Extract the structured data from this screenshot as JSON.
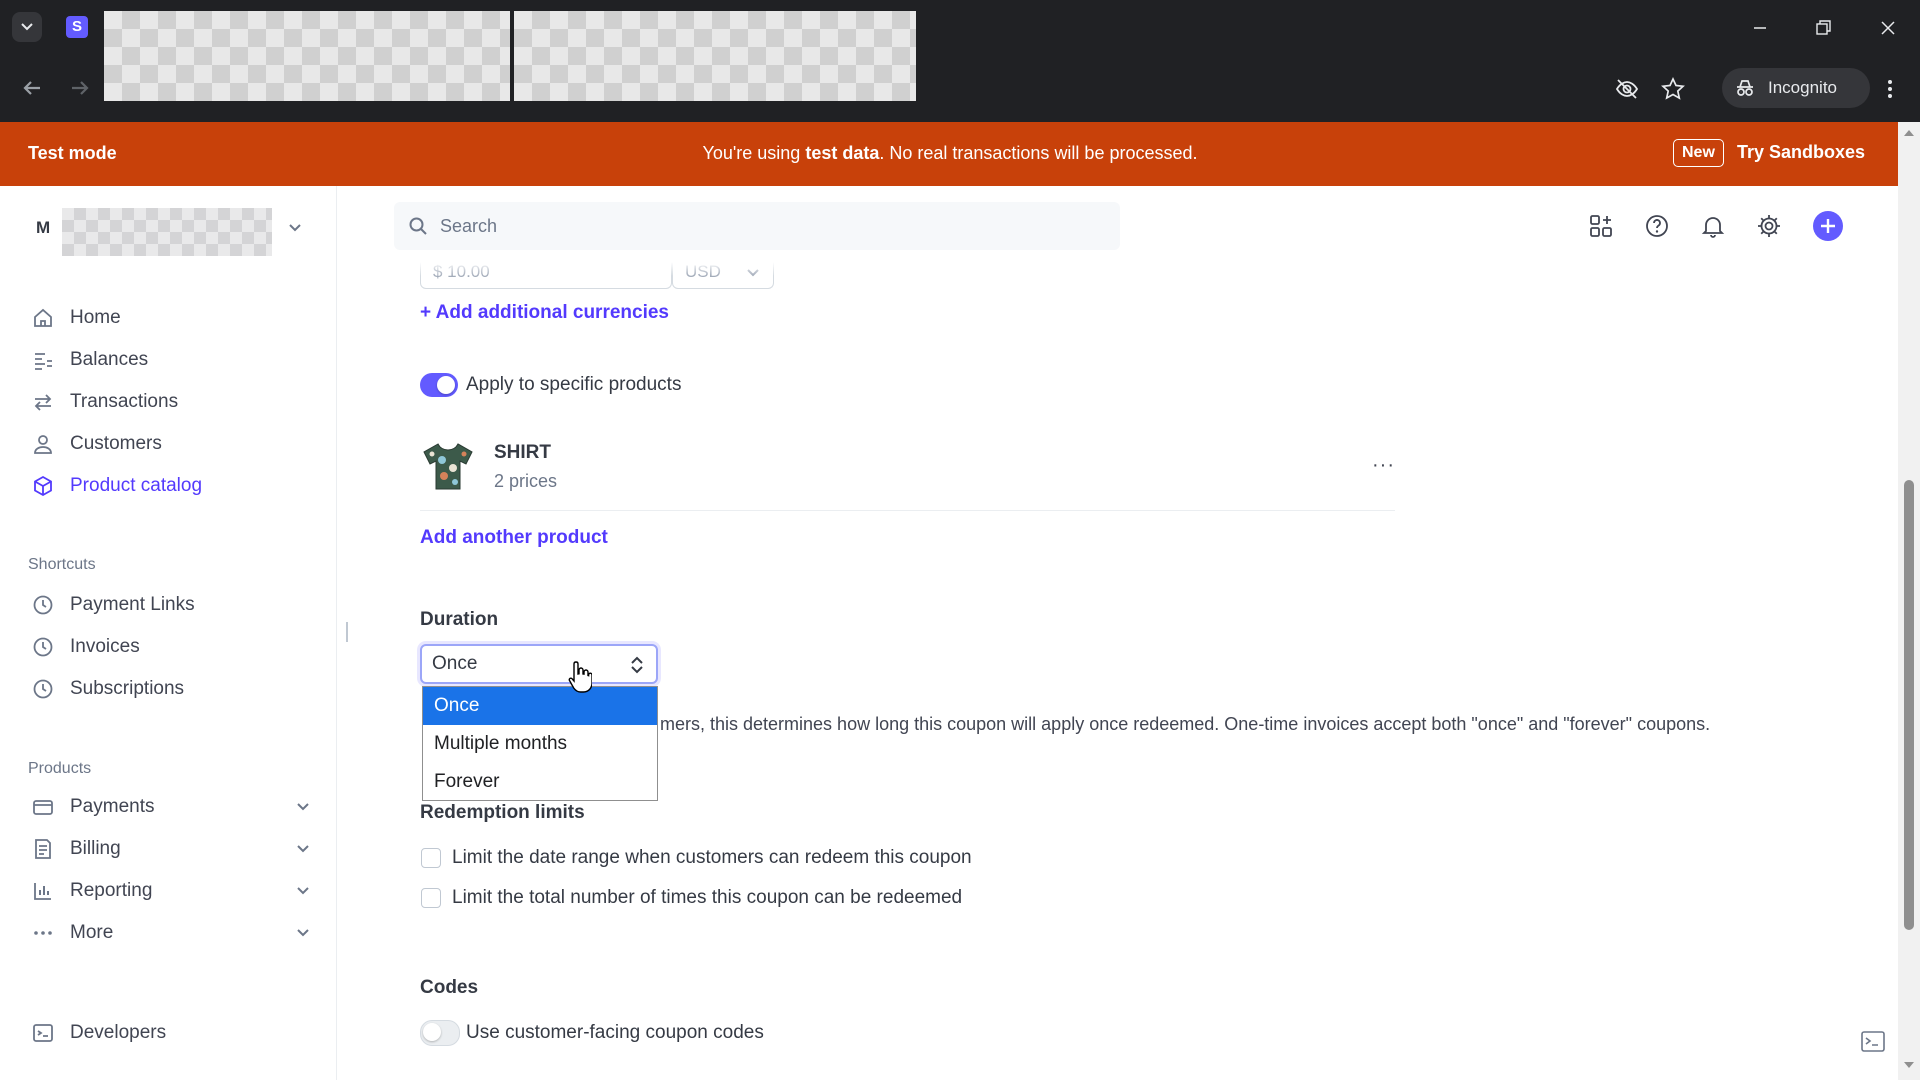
{
  "browser": {
    "incognito_label": "Incognito",
    "tab_favicon_letter": "S"
  },
  "banner": {
    "left": "Test mode",
    "center_prefix": "You're using ",
    "center_bold": "test data",
    "center_suffix": ". No real transactions will be processed.",
    "new_badge": "New",
    "try_link": "Try Sandboxes",
    "color": "#c8410a"
  },
  "account": {
    "initial": "M"
  },
  "sidebar": {
    "items": [
      {
        "label": "Home",
        "icon": "home-icon"
      },
      {
        "label": "Balances",
        "icon": "balances-icon"
      },
      {
        "label": "Transactions",
        "icon": "transactions-icon"
      },
      {
        "label": "Customers",
        "icon": "customers-icon"
      },
      {
        "label": "Product catalog",
        "icon": "product-catalog-icon",
        "active": true
      }
    ],
    "shortcuts_label": "Shortcuts",
    "shortcuts": [
      {
        "label": "Payment Links",
        "icon": "clock-icon"
      },
      {
        "label": "Invoices",
        "icon": "clock-icon"
      },
      {
        "label": "Subscriptions",
        "icon": "clock-icon"
      }
    ],
    "products_label": "Products",
    "products": [
      {
        "label": "Payments",
        "icon": "payments-icon"
      },
      {
        "label": "Billing",
        "icon": "billing-icon"
      },
      {
        "label": "Reporting",
        "icon": "reporting-icon"
      },
      {
        "label": "More",
        "icon": "more-icon"
      }
    ],
    "developers": "Developers"
  },
  "topbar": {
    "search_placeholder": "Search"
  },
  "form": {
    "amount_partial": "$ 10.00",
    "currency_partial": "USD",
    "add_currencies": "+ Add additional currencies",
    "apply_products_label": "Apply to specific products",
    "apply_products_on": true,
    "product": {
      "name": "SHIRT",
      "prices": "2 prices",
      "menu": "···"
    },
    "add_product": "Add another product",
    "duration": {
      "title": "Duration",
      "value": "Once",
      "options": [
        "Once",
        "Multiple months",
        "Forever"
      ],
      "selected_index": 0,
      "help_partial": "mers, this determines how long this coupon will apply once redeemed. One-time invoices accept both \"once\" and \"forever\" coupons."
    },
    "redemption": {
      "title": "Redemption limits",
      "limit_date": "Limit the date range when customers can redeem this coupon",
      "limit_total": "Limit the total number of times this coupon can be redeemed"
    },
    "codes": {
      "title": "Codes",
      "use_codes": "Use customer-facing coupon codes",
      "use_codes_on": false
    }
  },
  "colors": {
    "accent": "#635bff",
    "link": "#533afd"
  }
}
